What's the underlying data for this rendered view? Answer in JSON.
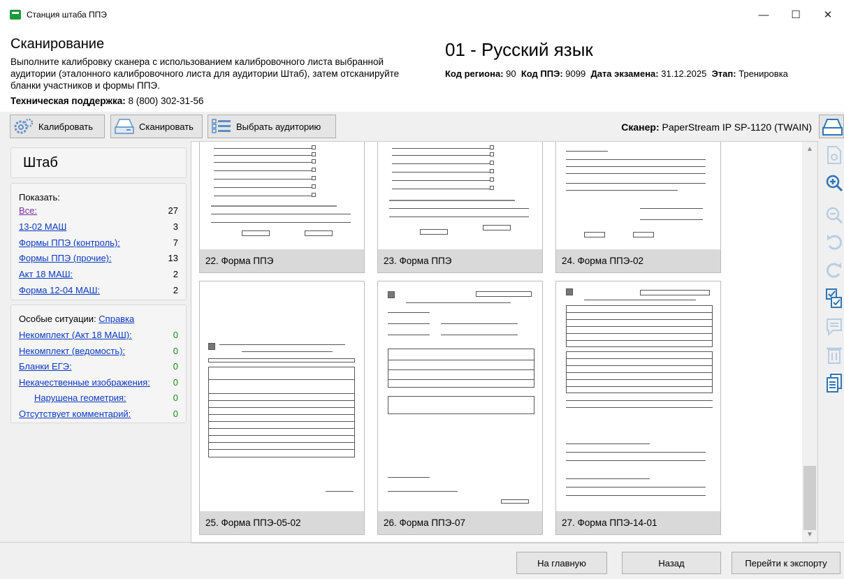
{
  "window": {
    "title": "Станция штаба ППЭ",
    "controls": [
      "—",
      "☐",
      "✕"
    ]
  },
  "header": {
    "title": "Сканирование",
    "description": "Выполните калибровку сканера с использованием калибровочного листа выбранной аудитории (эталонного калибровочного листа для аудитории Штаб), затем отсканируйте бланки участников и формы ППЭ.",
    "support_label": "Техническая поддержка:",
    "support_phone": "8 (800) 302-31-56",
    "exam": "01 - Русский язык",
    "region_label": "Код региона:",
    "region": "90",
    "ppe_label": "Код ППЭ:",
    "ppe": "9099",
    "date_label": "Дата экзамена:",
    "date": "31.12.2025",
    "stage_label": "Этап:",
    "stage": "Тренировка"
  },
  "toolbar": {
    "calibrate": "Калибровать",
    "scan": "Сканировать",
    "select_room": "Выбрать аудиторию",
    "scanner_label": "Сканер:",
    "scanner": "PaperStream IP SP-1120 (TWAIN)"
  },
  "sidebar": {
    "room": "Штаб",
    "show_label": "Показать:",
    "filters": [
      {
        "label": "Все:",
        "count": "27"
      },
      {
        "label": "13-02 МАШ",
        "count": "3"
      },
      {
        "label": "Формы ППЭ (контроль):",
        "count": "7"
      },
      {
        "label": "Формы ППЭ (прочие):",
        "count": "13"
      },
      {
        "label": "Акт 18 МАШ:",
        "count": "2"
      },
      {
        "label": "Форма 12-04 МАШ:",
        "count": "2"
      }
    ],
    "special_label": "Особые ситуации:",
    "help": "Справка",
    "special": [
      {
        "label": "Некомплект (Акт 18 МАШ):",
        "count": "0"
      },
      {
        "label": "Некомплект (ведомость):",
        "count": "0"
      },
      {
        "label": "Бланки ЕГЭ:",
        "count": "0"
      },
      {
        "label": "Некачественные изображения:",
        "count": "0"
      },
      {
        "label": "Нарушена геометрия:",
        "count": "0"
      },
      {
        "label": "Отсутствует комментарий:",
        "count": "0"
      }
    ]
  },
  "documents": [
    {
      "caption": "22. Форма ППЭ"
    },
    {
      "caption": "23. Форма ППЭ"
    },
    {
      "caption": "24. Форма ППЭ-02"
    },
    {
      "caption": "25. Форма ППЭ-05-02"
    },
    {
      "caption": "26. Форма ППЭ-07"
    },
    {
      "caption": "27. Форма ППЭ-14-01"
    }
  ],
  "footer": {
    "home": "На главную",
    "back": "Назад",
    "export": "Перейти к экспорту"
  },
  "colors": {
    "link": "#0b39c2",
    "visited": "#7a2aa6",
    "zero": "#1a8a1a",
    "tool": "#2e75b6"
  }
}
